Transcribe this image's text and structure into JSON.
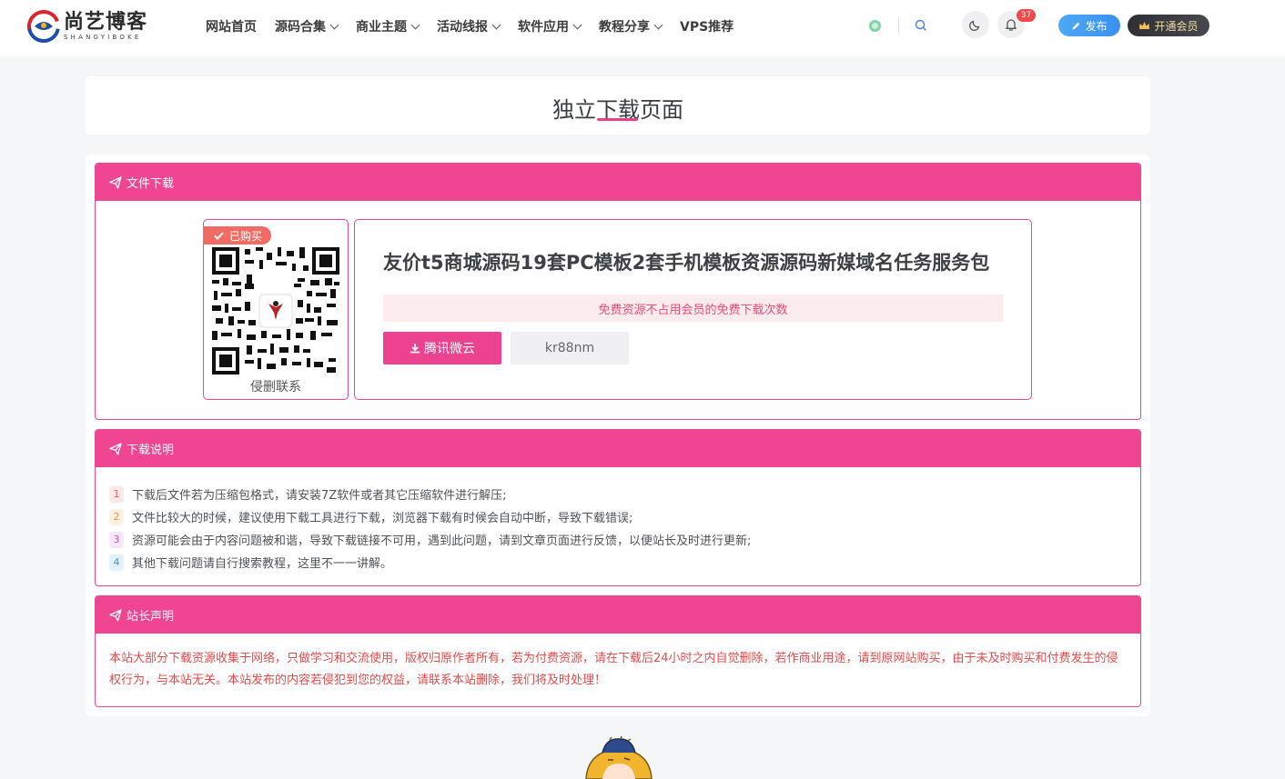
{
  "header": {
    "logo_cn": "尚艺博客",
    "logo_en": "SHANGYIBOKE",
    "nav": [
      {
        "label": "网站首页",
        "dropdown": false
      },
      {
        "label": "源码合集",
        "dropdown": true
      },
      {
        "label": "商业主题",
        "dropdown": true
      },
      {
        "label": "活动线报",
        "dropdown": true
      },
      {
        "label": "软件应用",
        "dropdown": true
      },
      {
        "label": "教程分享",
        "dropdown": true
      },
      {
        "label": "VPS推荐",
        "dropdown": false
      }
    ],
    "notification_count": "37",
    "publish_label": "发布",
    "vip_label": "开通会员"
  },
  "page": {
    "title": "独立下载页面"
  },
  "download": {
    "section_title": "文件下载",
    "bought_badge": "已购买",
    "qr_caption": "侵删联系",
    "resource_title": "友价t5商城源码19套PC模板2套手机模板资源源码新媒域名任务服务包",
    "notice": "免费资源不占用会员的免费下载次数",
    "download_button": "腾讯微云",
    "extract_code": "kr88nm"
  },
  "instructions": {
    "section_title": "下载说明",
    "items": [
      {
        "num": "1",
        "text": "下载后文件若为压缩包格式，请安装7Z软件或者其它压缩软件进行解压;"
      },
      {
        "num": "2",
        "text": "文件比较大的时候，建议使用下载工具进行下载，浏览器下载有时候会自动中断，导致下载错误;"
      },
      {
        "num": "3",
        "text": "资源可能会由于内容问题被和谐，导致下载链接不可用，遇到此问题，请到文章页面进行反馈，以便站长及时进行更新;"
      },
      {
        "num": "4",
        "text": "其他下载问题请自行搜索教程，这里不一一讲解。"
      }
    ]
  },
  "statement": {
    "section_title": "站长声明",
    "text": "本站大部分下载资源收集于网络，只做学习和交流使用，版权归原作者所有，若为付费资源，请在下载后24小时之内自觉删除，若作商业用途，请到原网站购买，由于未及时购买和付费发生的侵权行为，与本站无关。本站发布的内容若侵犯到您的权益，请联系本站删除，我们将及时处理！"
  },
  "colors": {
    "accent": "#ef4592",
    "statement_text": "#e24b4b"
  }
}
